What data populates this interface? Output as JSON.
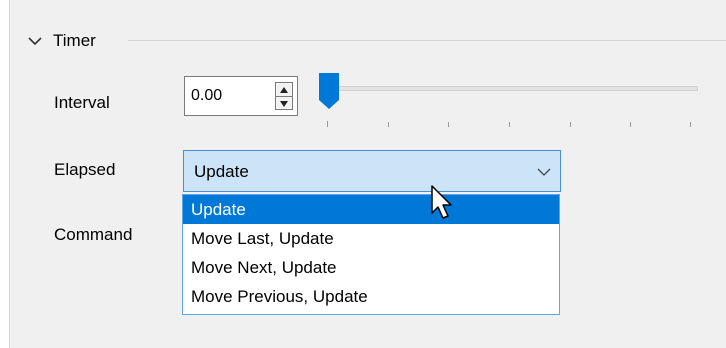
{
  "section": {
    "title": "Timer",
    "icon": "chevron-down-icon"
  },
  "interval": {
    "label": "Interval",
    "value": "0.00",
    "slider_fraction": 0
  },
  "elapsed": {
    "label": "Elapsed",
    "selected": "Update",
    "options": [
      "Update",
      "Move Last, Update",
      "Move Next, Update",
      "Move Previous, Update"
    ]
  },
  "command": {
    "label": "Command"
  },
  "colors": {
    "accent": "#0078d7",
    "combo_bg": "#cce4f7",
    "panel_bg": "#f0f0f0"
  }
}
